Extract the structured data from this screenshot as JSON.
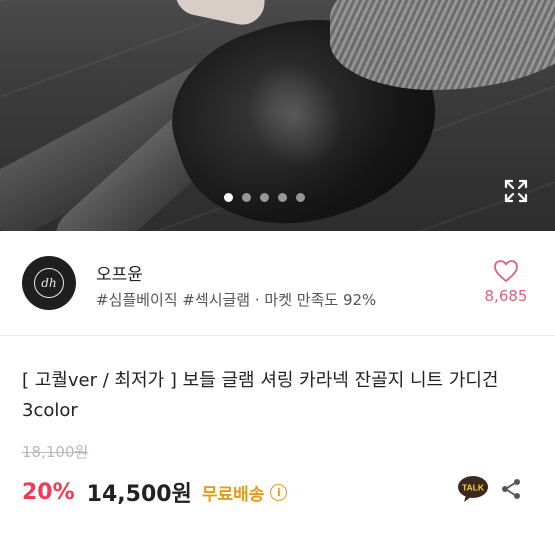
{
  "gallery": {
    "dot_count": 5,
    "active_index": 0,
    "expand_icon": "expand-icon"
  },
  "shop": {
    "name": "오프윤",
    "tags": "#심플베이직 #섹시글램 · 마켓 만족도 92%",
    "avatar_text": "dh",
    "favorite_count": "8,685",
    "favorite_icon": "heart-icon",
    "accent_color": "#e0607a"
  },
  "product": {
    "title": "[ 고퀄ver / 최저가 ] 보들 글램 셔링 카라넥 잔골지 니트 가디건 3color",
    "original_price": "18,100원",
    "discount": "20%",
    "price": "14,500원",
    "shipping": "무료배송",
    "discount_color": "#ef3b56",
    "shipping_color": "#e69a1a"
  },
  "actions": {
    "talk_label": "TALK",
    "share_icon": "share-icon"
  }
}
